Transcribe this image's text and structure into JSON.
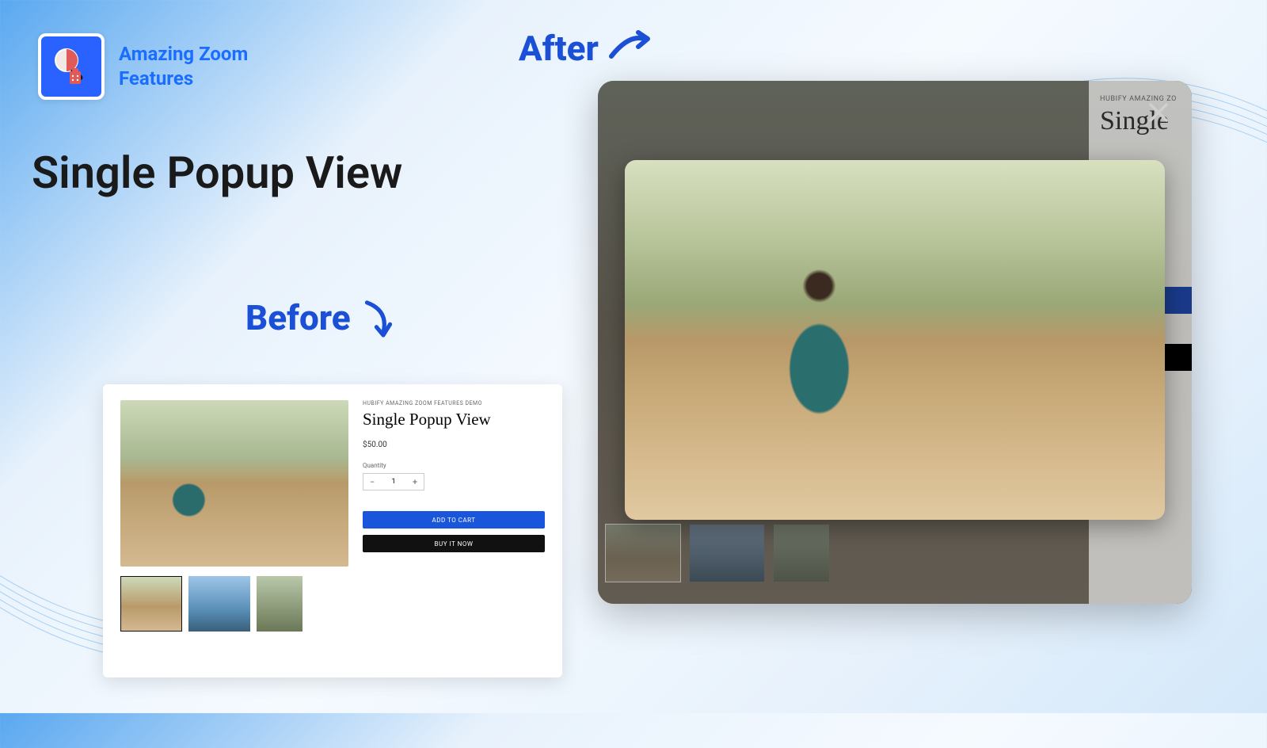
{
  "brand": {
    "name": "Amazing Zoom\nFeatures"
  },
  "page_title": "Single Popup View",
  "labels": {
    "before": "Before",
    "after": "After"
  },
  "before": {
    "brand_line": "HUBIFY AMAZING ZOOM FEATURES DEMO",
    "title": "Single Popup View",
    "price": "$50.00",
    "qty_label": "Quantity",
    "qty_value": "1",
    "add_to_cart": "ADD TO CART",
    "buy_now": "BUY IT NOW"
  },
  "after": {
    "strip_brand": "HUBIFY AMAZING ZO",
    "strip_title": "Single"
  }
}
